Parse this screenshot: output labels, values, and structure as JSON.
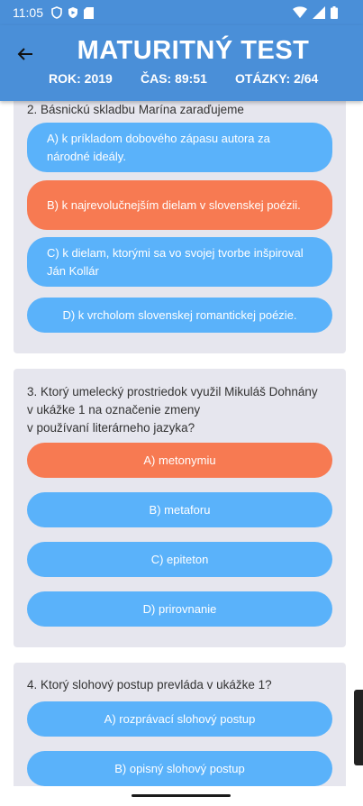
{
  "status": {
    "time": "11:05"
  },
  "header": {
    "title": "MATURITNÝ TEST",
    "year": "ROK: 2019",
    "time": "ČAS: 89:51",
    "questions": "OTÁZKY: 2/64"
  },
  "questions": [
    {
      "text": "2. Básnickú skladbu Marína zaraďujeme",
      "options": [
        {
          "label": "A) k príkladom dobového zápasu autora za národné ideály.",
          "selected": false
        },
        {
          "label": "B) k najrevolučnejším dielam v slovenskej poézii.",
          "selected": true
        },
        {
          "label": "C) k dielam, ktorými sa vo svojej tvorbe inšpiroval Ján Kollár",
          "selected": false
        },
        {
          "label": "D) k vrcholom slovenskej romantickej poézie.",
          "selected": false
        }
      ]
    },
    {
      "text": "3. Ktorý umelecký prostriedok využil Mikuláš Dohnány v ukážke 1 na označenie zmeny v používaní literárneho jazyka?",
      "text_lines": [
        "3. Ktorý umelecký prostriedok využil Mikuláš Dohnány",
        "v ukážke 1 na označenie zmeny",
        "v používaní literárneho jazyka?"
      ],
      "options": [
        {
          "label": "A) metonymiu",
          "selected": true
        },
        {
          "label": "B) metaforu",
          "selected": false
        },
        {
          "label": "C) epiteton",
          "selected": false
        },
        {
          "label": "D) prirovnanie",
          "selected": false
        }
      ]
    },
    {
      "text": "4. Ktorý slohový postup prevláda v ukážke 1?",
      "options": [
        {
          "label": "A) rozprávací slohový postup",
          "selected": false
        },
        {
          "label": "B) opisný slohový postup",
          "selected": false
        }
      ]
    }
  ],
  "colors": {
    "header": "#4a8fd8",
    "option": "#5ab2fa",
    "selected": "#f77a52",
    "card": "#e6e6ee"
  }
}
